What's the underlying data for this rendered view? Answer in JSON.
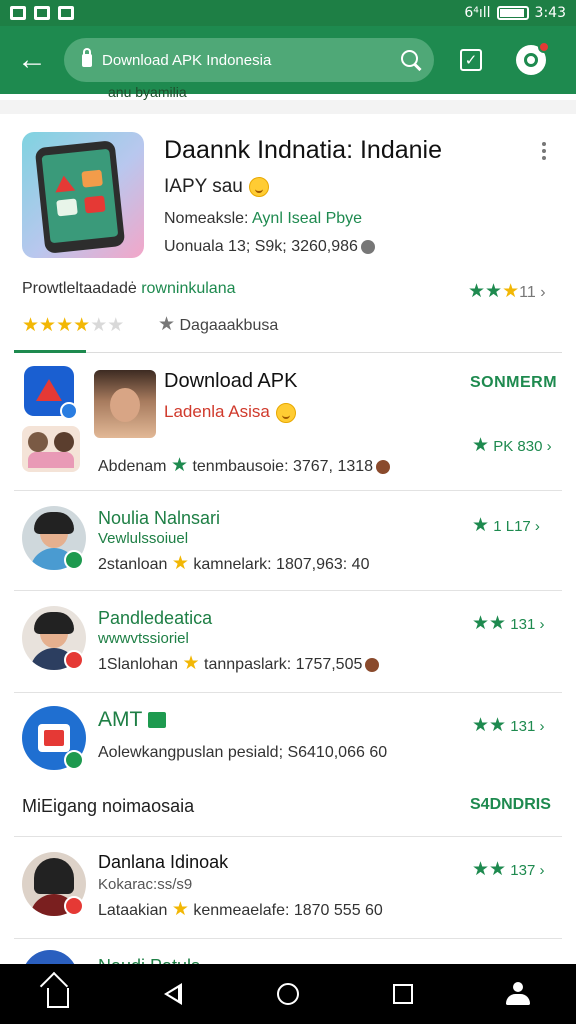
{
  "status_bar": {
    "left_icons": [
      "photo-icon",
      "mail-icon",
      "image-icon"
    ],
    "signal_text": "6⁴ıll",
    "time": "3:43"
  },
  "app_bar": {
    "search_text": "Download APK Indonesia"
  },
  "scrolled_partial_text": "anu byamilia",
  "hero": {
    "title": "Daannk Indnatia: Indanie",
    "subtitle": "IAPY sau",
    "meta_label": "Nomeaksle:",
    "meta_link": "Aynl Iseal Pbye",
    "meta2": "Uonuala 13; S9k; 3260,986",
    "developer_label": "Prowtleltaadadė",
    "developer_link": "rowninkulana",
    "rating_right": "11",
    "category": "Dagaaakbusa"
  },
  "featured": {
    "title": "Download APK",
    "subtitle": "Ladenla Asisa",
    "action": "SONMERM",
    "rating": "PK 830",
    "meta_prefix": "Abdenam",
    "meta_rest": "tenmbausoie: 3767, 1318"
  },
  "list": [
    {
      "title": "Noulia Nalnsari",
      "subtitle": "Vewlulssoiuel",
      "meta_prefix": "2stanloan",
      "meta_rest": "kamnelark: 1807,963: 40",
      "rating": "1 L17"
    },
    {
      "title": "Pandledeatica",
      "subtitle": "wwwvtssioriel",
      "meta_prefix": "1Slanlohan",
      "meta_rest": "tannpaslark: 1757,505",
      "rating": "131"
    },
    {
      "title": "AMT",
      "subtitle": "",
      "meta_prefix": "",
      "meta_rest": "Aolewkangpuslan pesiald; S6410,066 60",
      "rating": "131"
    },
    {
      "title": "Danlana Idinoak",
      "subtitle": "Kokarac:ss/s9",
      "meta_prefix": "Lataakian",
      "meta_rest": "kenmeaelafe: 1870 555 60",
      "rating": "137"
    }
  ],
  "section": {
    "label": "MiEigang noimaosaia",
    "action": "S4DNDRIS"
  },
  "peek_text": "Naudi Patuls",
  "colors": {
    "primary": "#1e8a4f",
    "status_bar": "#1e7f45",
    "accent_red": "#d03a2c",
    "star_yellow": "#f2b705"
  }
}
